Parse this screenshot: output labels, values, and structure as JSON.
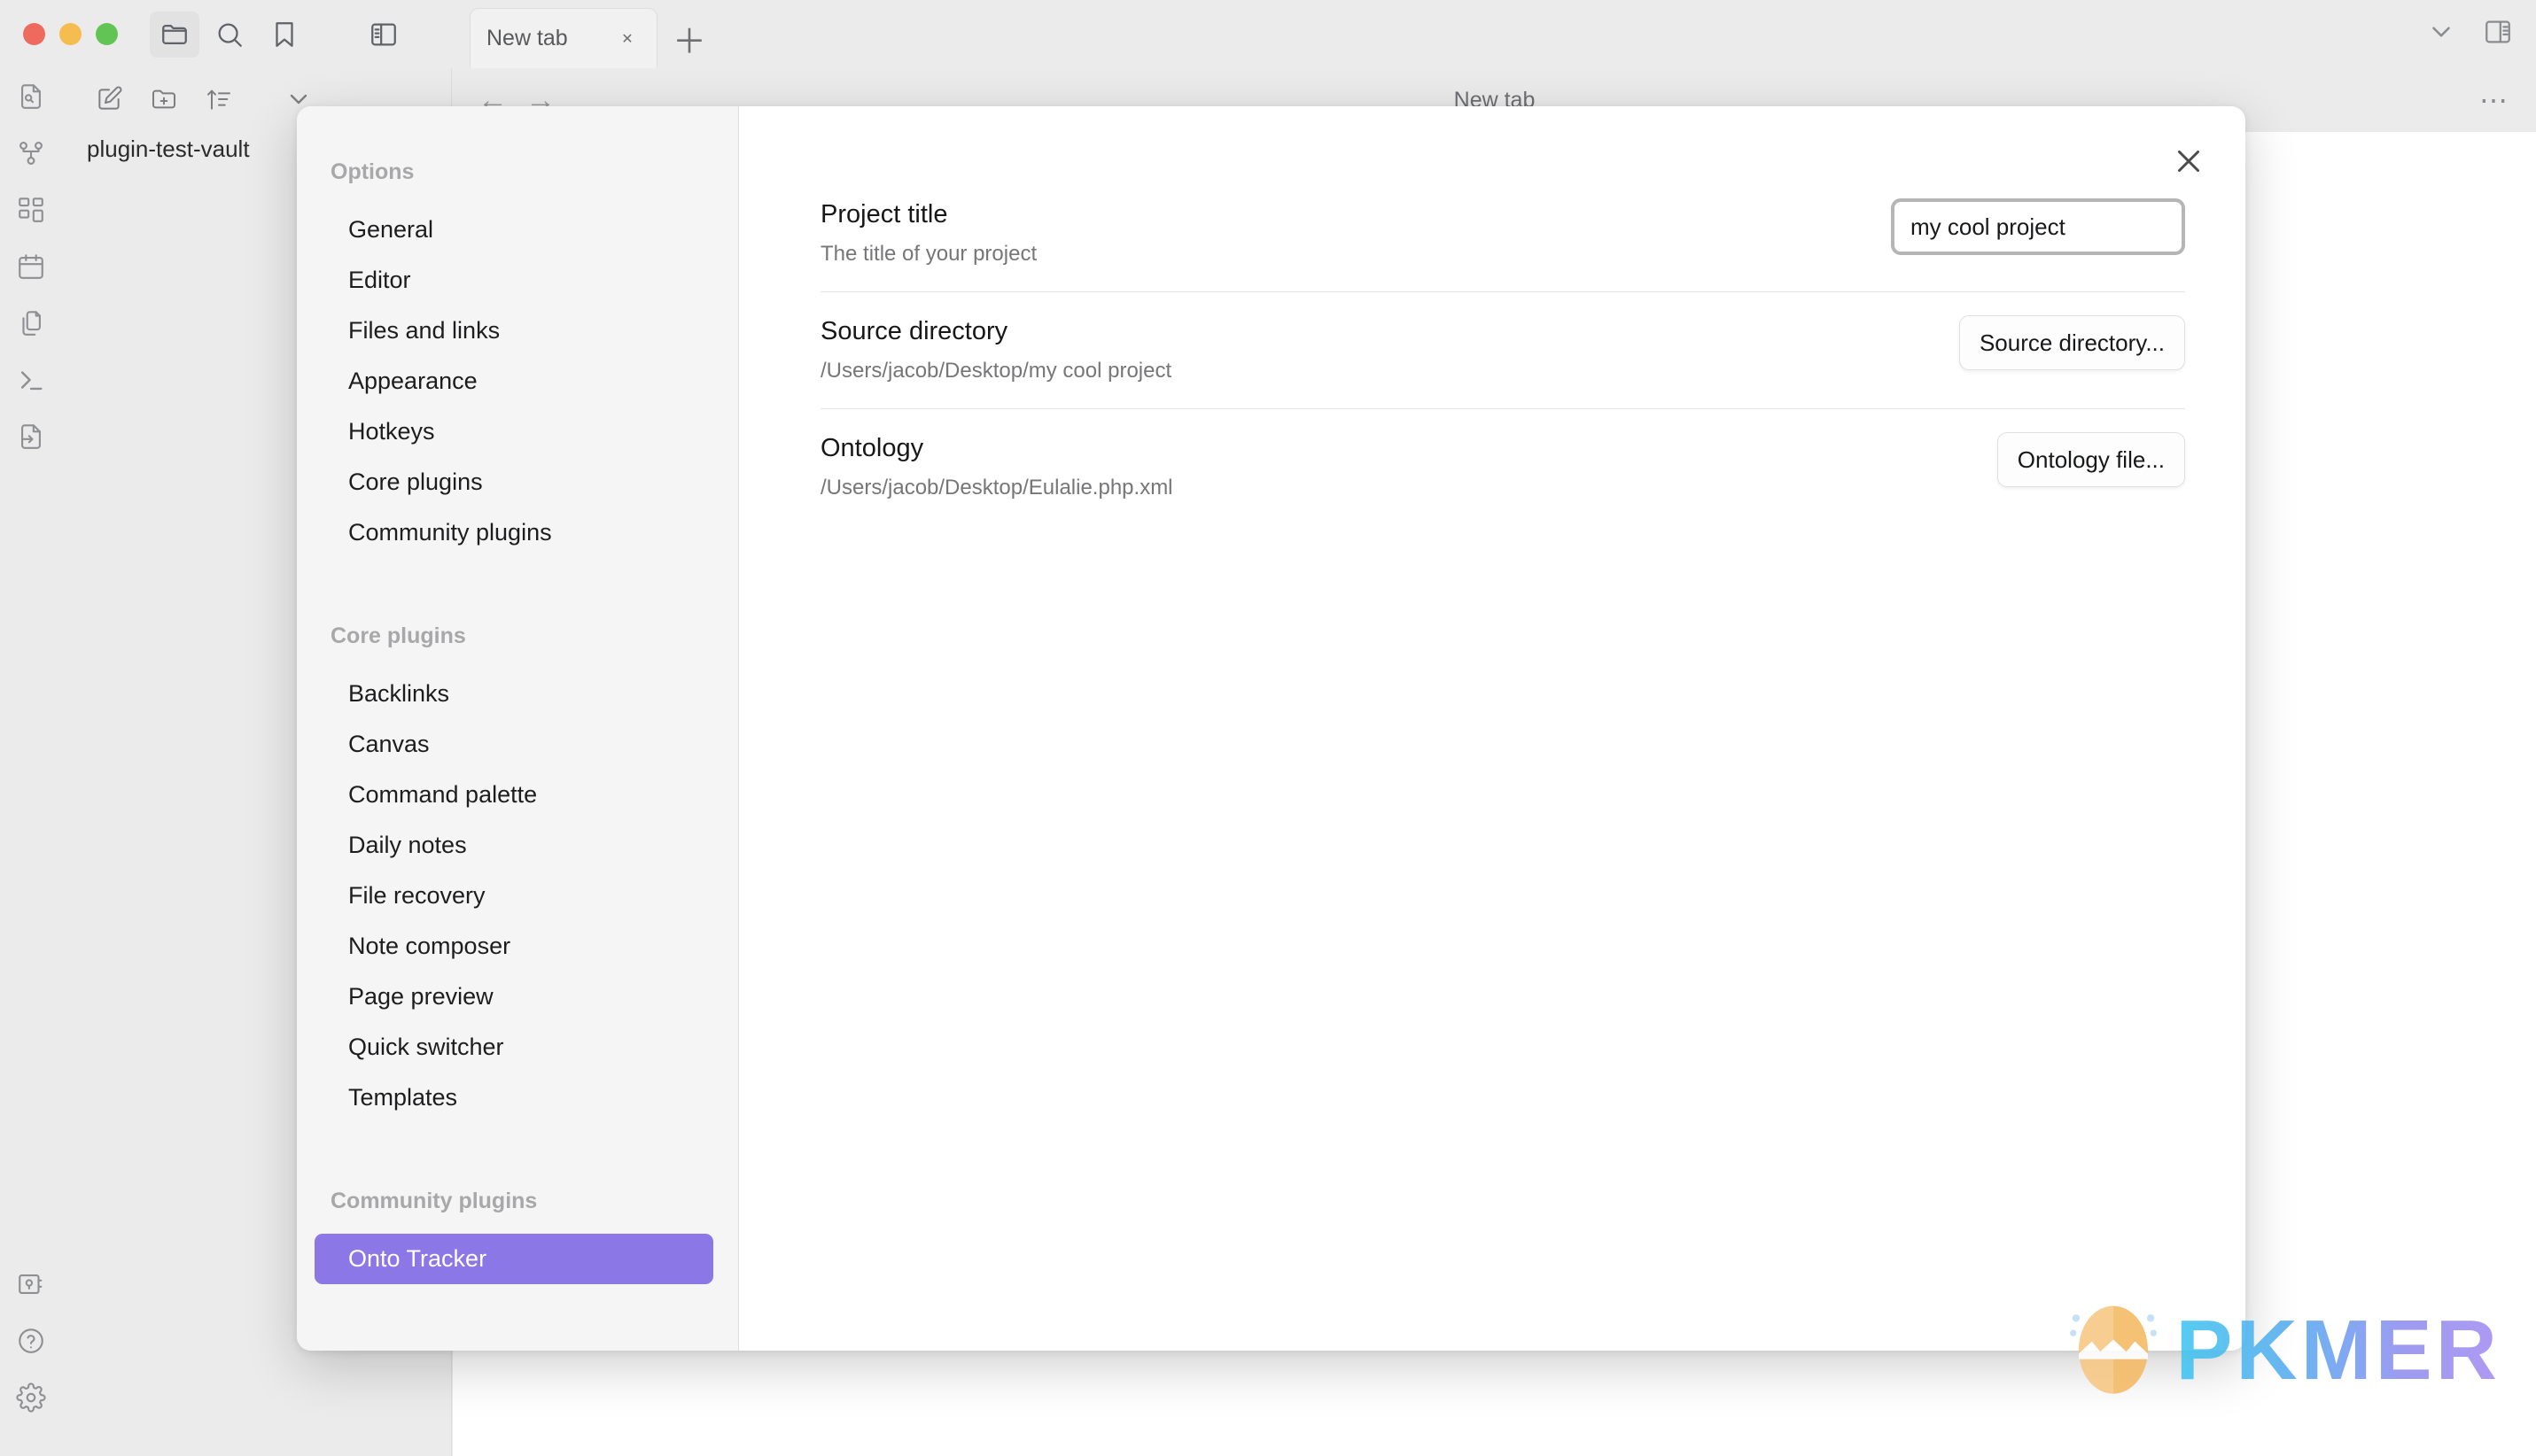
{
  "window": {
    "traffic_lights": [
      "close",
      "minimize",
      "maximize"
    ],
    "toolbar_icons": [
      "folder-icon",
      "search-icon",
      "bookmark-icon",
      "split-pane-icon"
    ],
    "right_icons": [
      "chevron-down-icon",
      "right-sidebar-icon"
    ]
  },
  "tabs": {
    "items": [
      {
        "label": "New tab",
        "close_label": "✕"
      }
    ],
    "new_tab_label": "＋"
  },
  "ribbon": {
    "top_icons": [
      "file-search-icon",
      "graph-view-icon",
      "canvas-icon",
      "daily-note-calendar-icon",
      "templates-copy-icon",
      "terminal-icon",
      "import-file-icon"
    ],
    "bottom_icons": [
      "vault-icon",
      "help-icon",
      "settings-gear-icon"
    ]
  },
  "explorer": {
    "toolbar_icons": [
      "new-note-icon",
      "new-folder-icon",
      "sort-icon",
      "collapse-icon"
    ],
    "vault_name": "plugin-test-vault"
  },
  "workspace": {
    "title": "New tab",
    "back_icon": "←",
    "forward_icon": "→",
    "more_icon": "⋯"
  },
  "settings_modal": {
    "close_icon": "✕",
    "sidebar": {
      "sections": [
        {
          "heading": "Options",
          "items": [
            {
              "label": "General",
              "selected": false
            },
            {
              "label": "Editor",
              "selected": false
            },
            {
              "label": "Files and links",
              "selected": false
            },
            {
              "label": "Appearance",
              "selected": false
            },
            {
              "label": "Hotkeys",
              "selected": false
            },
            {
              "label": "Core plugins",
              "selected": false
            },
            {
              "label": "Community plugins",
              "selected": false
            }
          ]
        },
        {
          "heading": "Core plugins",
          "items": [
            {
              "label": "Backlinks",
              "selected": false
            },
            {
              "label": "Canvas",
              "selected": false
            },
            {
              "label": "Command palette",
              "selected": false
            },
            {
              "label": "Daily notes",
              "selected": false
            },
            {
              "label": "File recovery",
              "selected": false
            },
            {
              "label": "Note composer",
              "selected": false
            },
            {
              "label": "Page preview",
              "selected": false
            },
            {
              "label": "Quick switcher",
              "selected": false
            },
            {
              "label": "Templates",
              "selected": false
            }
          ]
        },
        {
          "heading": "Community plugins",
          "items": [
            {
              "label": "Onto Tracker",
              "selected": true
            }
          ]
        }
      ],
      "selected_accent": "#8b77e6"
    },
    "settings": [
      {
        "name": "Project title",
        "description": "The title of your project",
        "control": "text",
        "value": "my cool project",
        "placeholder": ""
      },
      {
        "name": "Source directory",
        "description": "/Users/jacob/Desktop/my cool project",
        "control": "button",
        "button_label": "Source directory..."
      },
      {
        "name": "Ontology",
        "description": "/Users/jacob/Desktop/Eulalie.php.xml",
        "control": "button",
        "button_label": "Ontology file..."
      }
    ]
  },
  "watermark": {
    "text": "PKMER",
    "icon": "cracking-egg-icon"
  }
}
